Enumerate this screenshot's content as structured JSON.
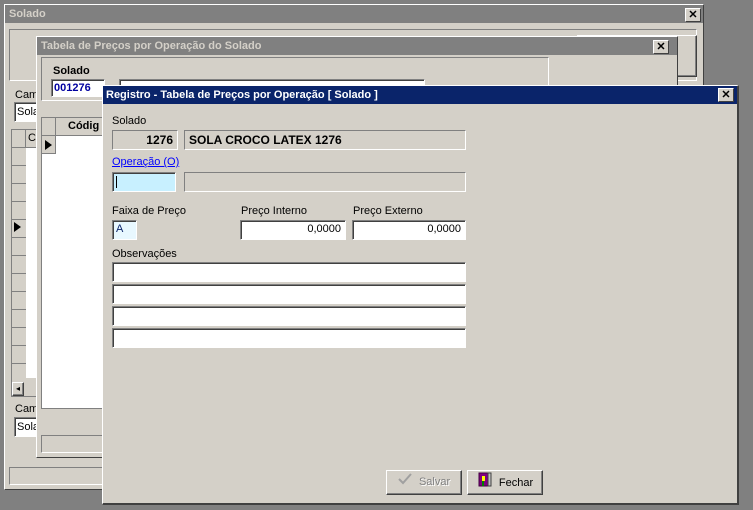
{
  "win1": {
    "title": "Solado",
    "close": "✕",
    "label_top": "Cam",
    "combo_top": "Sola",
    "label_bottom": "Cam",
    "combo_bottom": "Sola",
    "grid_col": "C"
  },
  "win2": {
    "title": "Tabela de Preços por Operação do Solado",
    "close": "✕",
    "solado_label": "Solado",
    "solado_value": "001276",
    "grid_col": "Códig"
  },
  "dialog": {
    "title": "Registro - Tabela de Preços por Operação [ Solado ]",
    "close": "✕",
    "solado_label": "Solado",
    "solado_code": "1276",
    "solado_desc": "SOLA CROCO LATEX 1276",
    "operacao_label": "Operação (O)",
    "operacao_value": "",
    "operacao_desc": "",
    "faixa_label": "Faixa de Preço",
    "faixa_value": "A",
    "preco_interno_label": "Preço Interno",
    "preco_interno_value": "0,0000",
    "preco_externo_label": "Preço Externo",
    "preco_externo_value": "0,0000",
    "observacoes_label": "Observações",
    "observacoes": [
      "",
      "",
      "",
      ""
    ],
    "salvar_label": "Salvar",
    "fechar_label": "Fechar"
  },
  "colors": {
    "active_title": "#0a246a",
    "inactive_title": "#808080",
    "face": "#d4d0c8",
    "focus_field": "#c8f0ff",
    "link": "#0000ff"
  },
  "icons": {
    "salvar": "check-icon",
    "fechar": "exit-door-icon",
    "row_pointer": "triangle-right-icon"
  }
}
